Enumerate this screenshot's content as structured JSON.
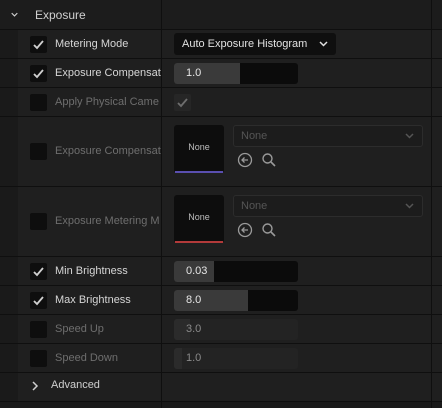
{
  "section": {
    "title": "Exposure",
    "expanded": true
  },
  "rows": {
    "metering_mode": {
      "label": "Metering Mode",
      "checked": true,
      "value": "Auto Exposure Histogram"
    },
    "exposure_comp": {
      "label": "Exposure Compensat",
      "checked": true,
      "value": "1.0"
    },
    "apply_physical": {
      "label": "Apply Physical Came",
      "checked": false,
      "value_checked": true
    },
    "exposure_comp_curve": {
      "label": "Exposure Compensat",
      "checked": false,
      "swatch_text": "None",
      "combo_text": "None",
      "accent": "#5a4fb0"
    },
    "metering_mask": {
      "label": "Exposure Metering M",
      "checked": false,
      "swatch_text": "None",
      "combo_text": "None",
      "accent": "#b23a3a"
    },
    "min_brightness": {
      "label": "Min Brightness",
      "checked": true,
      "value": "0.03"
    },
    "max_brightness": {
      "label": "Max Brightness",
      "checked": true,
      "value": "8.0"
    },
    "speed_up": {
      "label": "Speed Up",
      "checked": false,
      "value": "3.0"
    },
    "speed_down": {
      "label": "Speed Down",
      "checked": false,
      "value": "1.0"
    }
  },
  "advanced": {
    "label": "Advanced"
  },
  "colors": {
    "accent_check": "#cfcfcf",
    "background": "#1a1a1a"
  },
  "icons": {
    "chevron-down": "chevron-down-icon",
    "chevron-right": "chevron-right-icon",
    "reset": "arrow-left-circle-icon",
    "browse": "search-icon",
    "check": "checkmark-icon"
  }
}
